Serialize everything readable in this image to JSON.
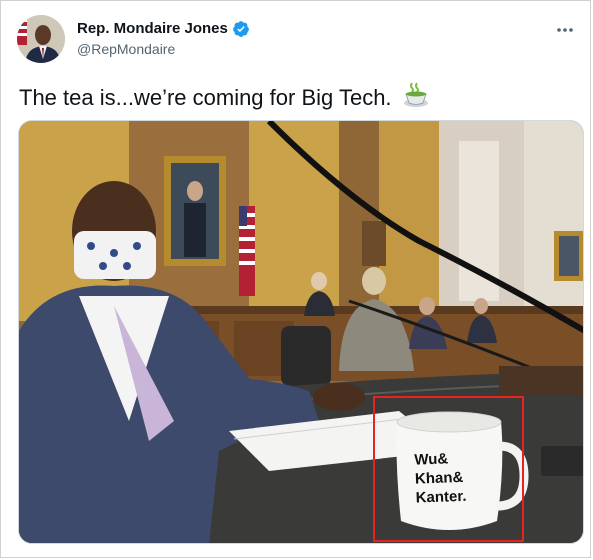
{
  "tweet": {
    "author": {
      "display_name": "Rep. Mondaire Jones",
      "handle": "@RepMondaire",
      "verified": true,
      "avatar_icon": "avatar-photo"
    },
    "text": "The tea is...we’re coming for Big Tech.",
    "emoji": "hot-beverage-emoji",
    "more_icon": "ellipsis-icon",
    "media": {
      "mug_lines": [
        "Wu&",
        "Khan&",
        "Kanter."
      ],
      "highlight_color": "#e8231f"
    }
  },
  "colors": {
    "verified_blue": "#1d9bf0",
    "text_primary": "#0f1419",
    "text_secondary": "#536471"
  }
}
